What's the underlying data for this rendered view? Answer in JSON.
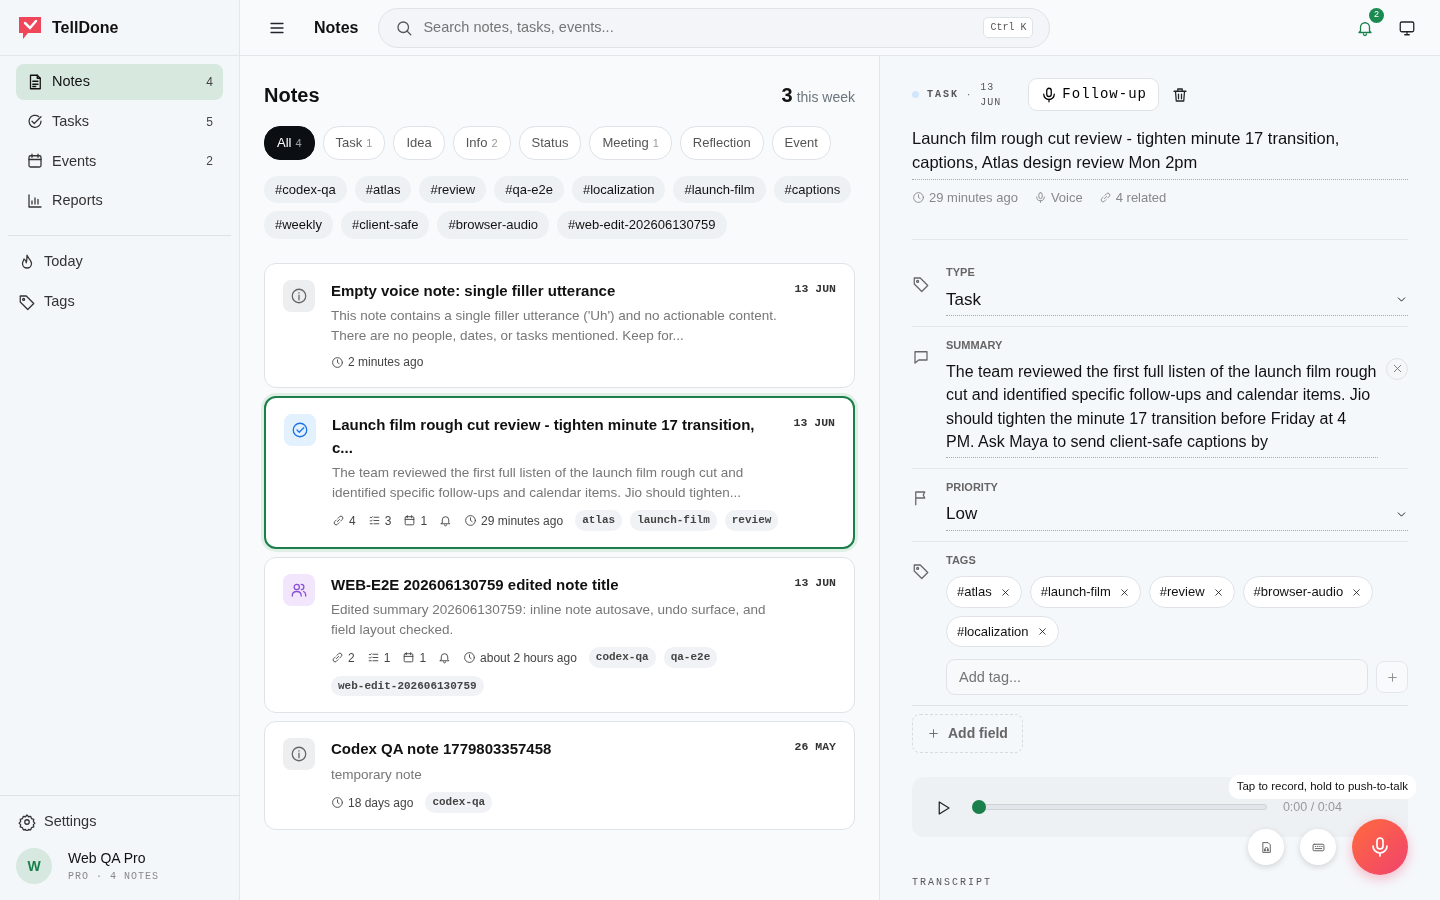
{
  "app": {
    "name": "TellDone"
  },
  "sidebar": {
    "nav": [
      {
        "kind": "notes",
        "label": "Notes",
        "count": "4",
        "selected": true
      },
      {
        "kind": "tasks",
        "label": "Tasks",
        "count": "5",
        "selected": false
      },
      {
        "kind": "events",
        "label": "Events",
        "count": "2",
        "selected": false
      },
      {
        "kind": "reports",
        "label": "Reports",
        "selected": false
      }
    ],
    "secondary": [
      {
        "kind": "today",
        "label": "Today"
      },
      {
        "kind": "tags",
        "label": "Tags"
      }
    ],
    "settings": "Settings",
    "user": {
      "initial": "W",
      "name": "Web QA Pro",
      "plan": "PRO · 4 NOTES"
    }
  },
  "header": {
    "title": "Notes",
    "search": {
      "placeholder": "Search notes, tasks, events...",
      "shortcut": "Ctrl K"
    },
    "notifications": "2"
  },
  "list": {
    "title": "Notes",
    "count": "3",
    "count_label": "this week",
    "filters": [
      {
        "label": "All",
        "count": "4",
        "selected": true
      },
      {
        "label": "Task",
        "count": "1",
        "selected": false
      },
      {
        "label": "Idea",
        "selected": false
      },
      {
        "label": "Info",
        "count": "2",
        "selected": false
      },
      {
        "label": "Status",
        "selected": false
      },
      {
        "label": "Meeting",
        "count": "1",
        "selected": false
      },
      {
        "label": "Reflection",
        "selected": false
      },
      {
        "label": "Event",
        "selected": false
      }
    ],
    "tags": [
      "#codex-qa",
      "#atlas",
      "#review",
      "#qa-e2e",
      "#localization",
      "#launch-film",
      "#captions",
      "#weekly",
      "#client-safe",
      "#browser-audio",
      "#web-edit-202606130759"
    ],
    "notes": [
      {
        "kind": "info",
        "title": "Empty voice note: single filler utterance",
        "summary": "This note contains a single filler utterance ('Uh') and no actionable content. There are no people, dates, or tasks mentioned. Keep for...",
        "date": "13 JUN",
        "selected": false,
        "reminder": false,
        "time": "2 minutes ago"
      },
      {
        "kind": "task",
        "title": "Launch film rough cut review - tighten minute 17 transition, c...",
        "summary": "The team reviewed the first full listen of the launch film rough cut and identified specific follow-ups and calendar items. Jio should tighten...",
        "date": "13 JUN",
        "selected": true,
        "links": "4",
        "tasks": "3",
        "events": "1",
        "reminder": true,
        "time": "29 minutes ago",
        "tags": [
          "atlas",
          "launch-film",
          "review"
        ]
      },
      {
        "kind": "meeting",
        "title": "WEB-E2E 202606130759 edited note title",
        "summary": "Edited summary 202606130759: inline note autosave, undo surface, and field layout checked.",
        "date": "13 JUN",
        "selected": false,
        "links": "2",
        "tasks": "1",
        "events": "1",
        "reminder": true,
        "time": "about 2 hours ago",
        "tags": [
          "codex-qa",
          "qa-e2e",
          "web-edit-202606130759"
        ]
      },
      {
        "kind": "info",
        "title": "Codex QA note 1779803357458",
        "summary": "temporary note",
        "date": "26 MAY",
        "selected": false,
        "reminder": false,
        "time": "18 days ago",
        "tags": [
          "codex-qa"
        ]
      }
    ]
  },
  "detail": {
    "type_label": "TASK",
    "separator": "·",
    "date": "13 JUN",
    "action": "Follow-up",
    "title": "Launch film rough cut review - tighten minute 17 transition, captions, Atlas design review Mon 2pm",
    "meta": [
      {
        "kind": "clock",
        "text": "29 minutes ago"
      },
      {
        "kind": "mic",
        "text": "Voice"
      },
      {
        "kind": "link",
        "text": "4 related"
      }
    ],
    "fields": [
      {
        "kind": "select",
        "label": "TYPE",
        "value": "Task"
      },
      {
        "kind": "text",
        "label": "SUMMARY",
        "value": "The team reviewed the first full listen of the launch film rough cut and identified specific follow-ups and calendar items. Jio should tighten the minute 17 transition before Friday at 4 PM. Ask Maya to send client-safe captions by"
      },
      {
        "kind": "select",
        "label": "PRIORITY",
        "value": "Low"
      },
      {
        "kind": "tags",
        "label": "TAGS",
        "tags": [
          "#atlas",
          "#launch-film",
          "#review",
          "#browser-audio",
          "#localization"
        ],
        "placeholder": "Add tag..."
      }
    ],
    "add_field": "Add field",
    "player": {
      "level": 0,
      "time": "0:00 / 0:04"
    },
    "tooltip": "Tap to record, hold to push-to-talk",
    "transcript_label": "TRANSCRIPT"
  }
}
